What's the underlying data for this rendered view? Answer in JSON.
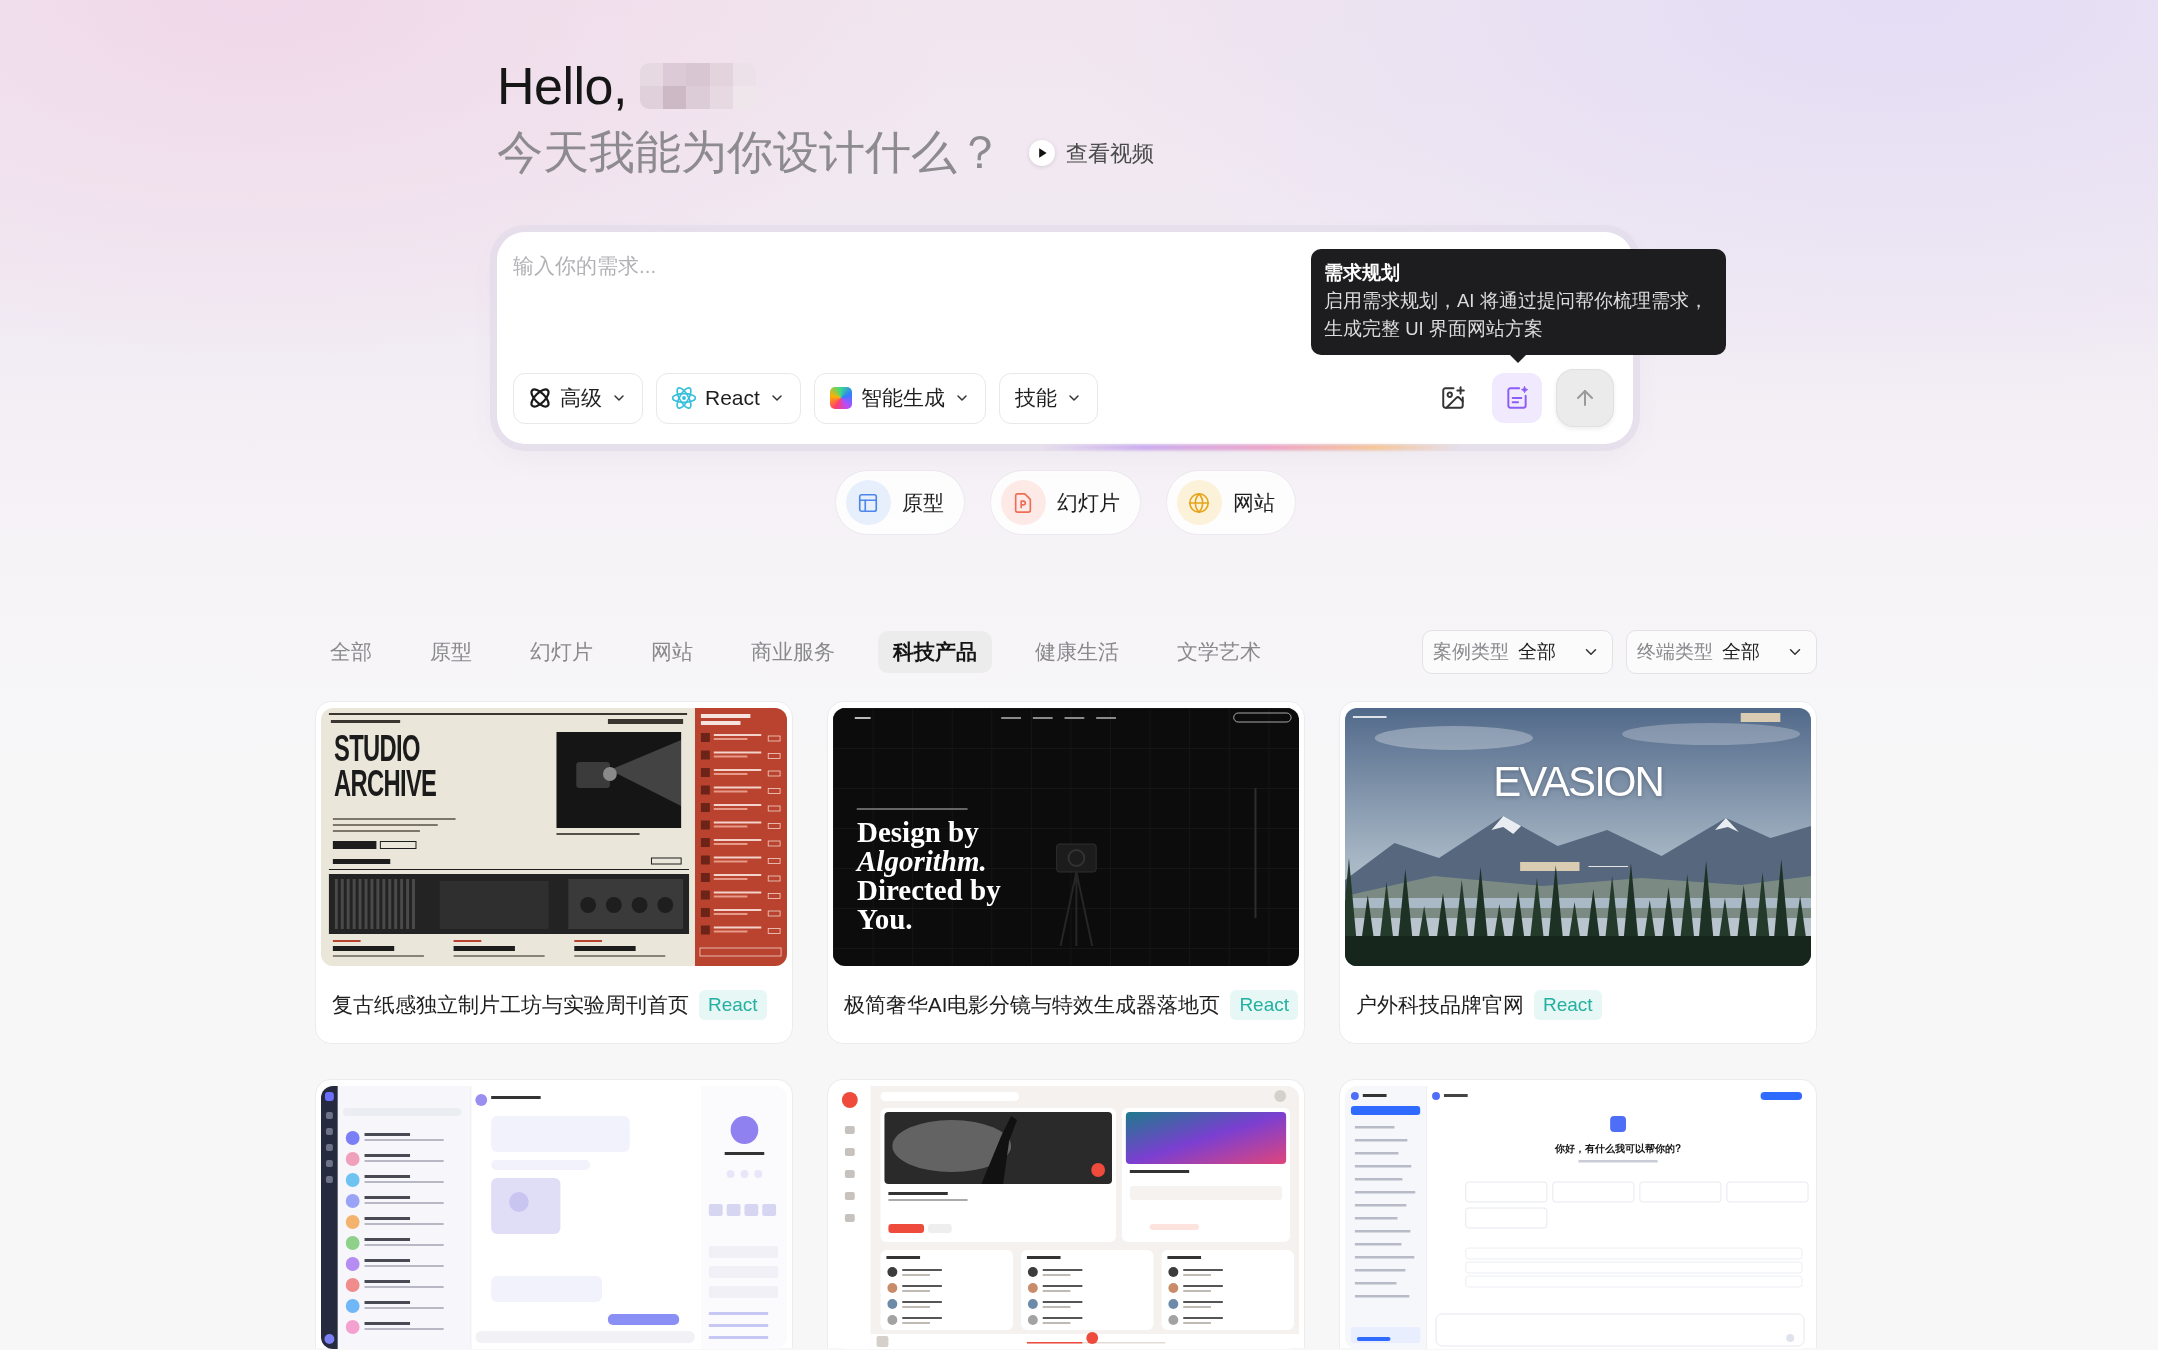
{
  "greeting": {
    "hello": "Hello,",
    "prompt": "今天我能为你设计什么？",
    "video_link": "查看视频"
  },
  "composer": {
    "placeholder": "输入你的需求...",
    "options": [
      {
        "kind": "orbit",
        "label": "高级"
      },
      {
        "kind": "react",
        "label": "React"
      },
      {
        "kind": "gradient",
        "label": "智能生成"
      },
      {
        "kind": "plain",
        "label": "技能"
      }
    ],
    "planning": {
      "active": true
    },
    "tooltip": {
      "title": "需求规划",
      "body": "启用需求规划，AI 将通过提问帮你梳理需求，生成完整 UI 界面网站方案"
    }
  },
  "quick_types": [
    {
      "kind": "prototype",
      "label": "原型"
    },
    {
      "kind": "slides",
      "label": "幻灯片"
    },
    {
      "kind": "website",
      "label": "网站"
    }
  ],
  "categories": [
    {
      "label": "全部",
      "selected": false
    },
    {
      "label": "原型",
      "selected": false
    },
    {
      "label": "幻灯片",
      "selected": false
    },
    {
      "label": "网站",
      "selected": false
    },
    {
      "label": "商业服务",
      "selected": false
    },
    {
      "label": "科技产品",
      "selected": true
    },
    {
      "label": "健康生活",
      "selected": false
    },
    {
      "label": "文学艺术",
      "selected": false
    }
  ],
  "filters": [
    {
      "label": "案例类型",
      "value": "全部"
    },
    {
      "label": "终端类型",
      "value": "全部"
    }
  ],
  "cases": [
    {
      "title": "复古纸感独立制片工坊与实验周刊首页",
      "tag": "React",
      "preview": {
        "kind": "editorial",
        "headline": "STUDIO ARCHIVE"
      }
    },
    {
      "title": "极简奢华AI电影分镜与特效生成器落地页",
      "tag": "React",
      "preview": {
        "kind": "cinematic",
        "headline": "Design by *Algorithm.* Directed by You."
      }
    },
    {
      "title": "户外科技品牌官网",
      "tag": "React",
      "preview": {
        "kind": "landscape",
        "headline": "EVASION"
      }
    },
    {
      "preview": {
        "kind": "chat-app"
      }
    },
    {
      "preview": {
        "kind": "music-app"
      }
    },
    {
      "preview": {
        "kind": "assistant",
        "headline": "你好，有什么我可以帮你的?"
      }
    }
  ]
}
